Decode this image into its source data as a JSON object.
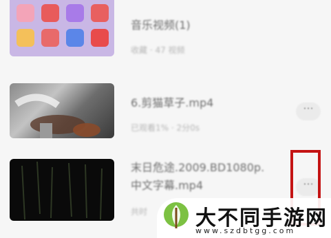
{
  "items": [
    {
      "title": "音乐视频(1)",
      "meta": "收藏 · 47 视频",
      "more_icon": "more-dots-icon"
    },
    {
      "title": "6.剪猫草子.mp4",
      "meta": "已观看1% · 2分0s",
      "more_icon": "more-dots-icon"
    },
    {
      "title_line1": "末日危途.2009.BD1080p.",
      "title_line2": "中文字幕.mp4",
      "meta": "共时",
      "more_icon": "more-dots-icon"
    }
  ],
  "thumb_app_colors": [
    "#f3a4b8",
    "#e85b5b",
    "#a87be8",
    "#e86060",
    "#f4c05a",
    "#e86a6a",
    "#5b86e8",
    "#e84b4b"
  ],
  "highlight_color": "#c41414",
  "watermark": {
    "text": "大不同手游网",
    "url": "www.szdbtgg.com",
    "leaf_color": "#7cc142"
  }
}
